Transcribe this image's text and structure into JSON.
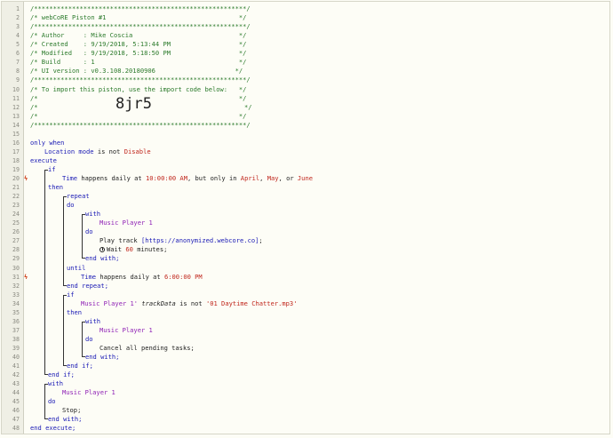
{
  "editor": {
    "header": {
      "rule": "/********************************************************/",
      "title_line": "/* webCoRE Piston #1                                   */",
      "author": "/* Author     : Mike Coscia                            */",
      "created": "/* Created    : 9/19/2018, 5:13:44 PM                  */",
      "modified": "/* Modified   : 9/19/2018, 5:18:50 PM                  */",
      "build": "/* Build      : 1                                      */",
      "ui_version": "/* UI version : v0.3.108.20180906                     */",
      "import_hint": "/* To import this piston, use the import code below:   */",
      "blank": "/*                                                     */",
      "import_left": "/*",
      "import_right": "*/",
      "import_code": "8jr5"
    },
    "code": {
      "only_when": "only when",
      "location_mode": "Location mode",
      "is_not": "is not",
      "disable": "Disable",
      "execute": "execute",
      "if": "if",
      "time": "Time",
      "happens_daily_at": "happens daily at",
      "time_10": "10:00:00 AM",
      "but_only_in": ", but only in",
      "april": "April",
      "comma": ",",
      "may": "May",
      "or": ", or",
      "june": "June",
      "then": "then",
      "repeat": "repeat",
      "do": "do",
      "with": "with",
      "music_player_1": "Music Player 1",
      "play_track": "Play track",
      "url": "[https://anonymized.webcore.co]",
      "semicolon": ";",
      "wait": "Wait",
      "wait_val": "60",
      "minutes": "minutes;",
      "end_with": "end with;",
      "until": "until",
      "time_6": "6:00:00 PM",
      "end_repeat": "end repeat;",
      "music_player_1q": "Music Player 1'",
      "track_data": "trackData",
      "track_value": "'01 Daytime Chatter.mp3'",
      "cancel_tasks": "Cancel all pending tasks;",
      "end_if": "end if;",
      "stop": "Stop;",
      "end_execute": "end execute;"
    },
    "line_numbers": [
      "1",
      "2",
      "3",
      "4",
      "5",
      "6",
      "7",
      "8",
      "9",
      "10",
      "11",
      "12",
      "13",
      "14",
      "15",
      "16",
      "17",
      "18",
      "19",
      "20",
      "21",
      "22",
      "23",
      "24",
      "25",
      "26",
      "27",
      "28",
      "29",
      "30",
      "31",
      "32",
      "33",
      "34",
      "35",
      "36",
      "37",
      "38",
      "39",
      "40",
      "41",
      "42",
      "43",
      "44",
      "45",
      "46",
      "47",
      "48"
    ],
    "trigger_marker": "ϟ"
  },
  "colors": {
    "comment": "#2b7a2b",
    "keyword": "#1a1ab5",
    "value": "#c0261c",
    "device": "#8e1fb5",
    "trigger": "#d0421b"
  }
}
